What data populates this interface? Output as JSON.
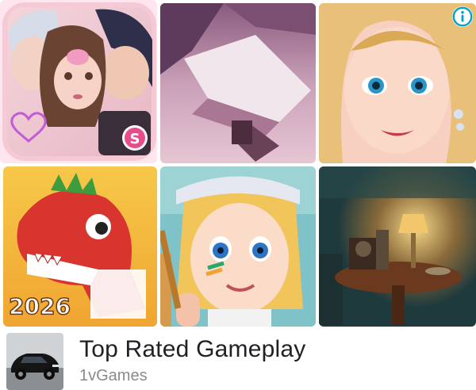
{
  "ad": {
    "tiles": [
      {
        "name": "romance-story-game-art",
        "badge_letter": "S"
      },
      {
        "name": "lowpoly-aircraft-game-art"
      },
      {
        "name": "makeover-princess-game-art"
      },
      {
        "name": "dinosaur-game-art",
        "year_badge": "2026"
      },
      {
        "name": "girl-painter-game-art"
      },
      {
        "name": "antique-room-hidden-object-game-art"
      }
    ],
    "info_icon": "info-icon",
    "app": {
      "title": "Top Rated Gameplay",
      "developer": "1vGames",
      "thumb_icon": "sports-car-icon"
    }
  }
}
